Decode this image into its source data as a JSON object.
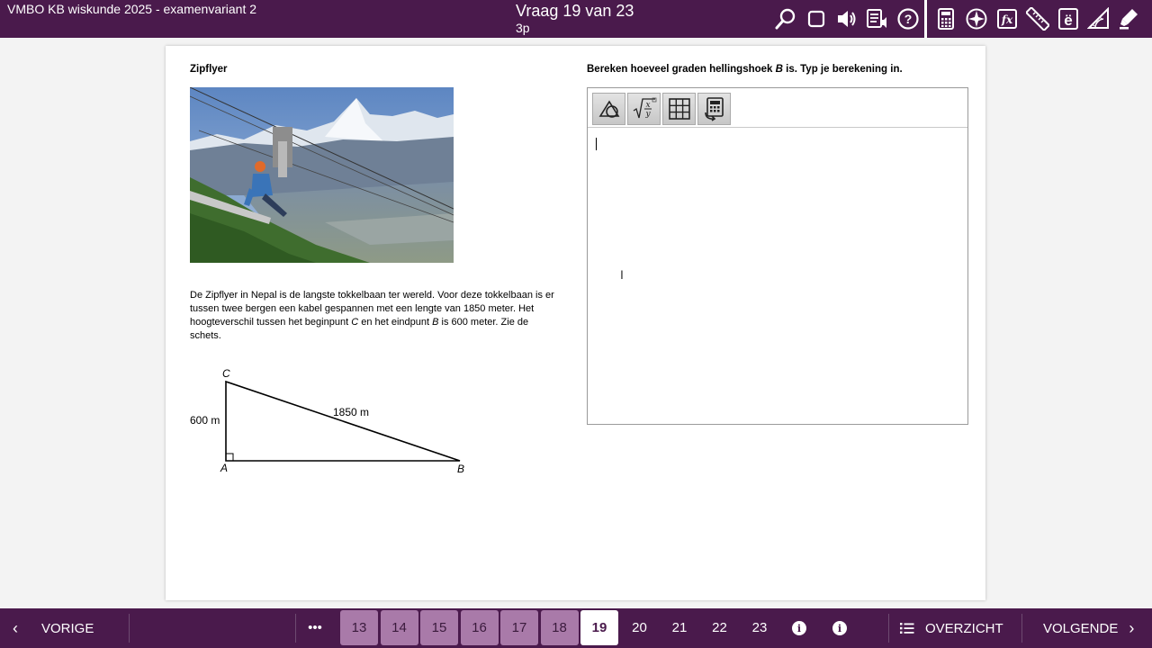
{
  "header": {
    "exam_title": "VMBO KB wiskunde 2025 - examenvariant 2",
    "question_title": "Vraag 19 van 23",
    "points": "3p",
    "tools_left": [
      "search-icon",
      "stop-icon",
      "speaker-icon",
      "read-aloud-icon",
      "help-icon"
    ],
    "tools_right": [
      "calculator-icon",
      "compass-icon",
      "formula-icon",
      "ruler-icon",
      "character-icon",
      "protractor-icon",
      "highlighter-icon"
    ]
  },
  "left": {
    "title": "Zipflyer",
    "intro_parts": {
      "p1": "De Zipflyer in Nepal is de langste tokkelbaan ter wereld. Voor deze tokkelbaan is er tussen twee bergen een kabel gespannen met een lengte van 1850 meter. Het hoogteverschil tussen het beginpunt ",
      "c": "C",
      "p2": " en het eindpunt ",
      "b": "B",
      "p3": " is 600 meter. Zie de schets."
    },
    "triangle": {
      "label_c": "C",
      "label_a": "A",
      "label_b": "B",
      "side_ac": "600 m",
      "side_cb": "1850 m"
    }
  },
  "right": {
    "question_parts": {
      "p1": "Bereken hoeveel graden hellingshoek ",
      "b": "B",
      "p2": " is. Typ je berekening in."
    },
    "editor_tools": [
      "geometry-icon",
      "formula-editor-icon",
      "table-icon",
      "calculator-paste-icon"
    ],
    "answer_value": ""
  },
  "footer": {
    "prev_label": "VORIGE",
    "more_label": "•••",
    "questions": [
      {
        "num": "13",
        "state": "visited"
      },
      {
        "num": "14",
        "state": "visited"
      },
      {
        "num": "15",
        "state": "visited"
      },
      {
        "num": "16",
        "state": "visited"
      },
      {
        "num": "17",
        "state": "visited"
      },
      {
        "num": "18",
        "state": "visited"
      },
      {
        "num": "19",
        "state": "current"
      },
      {
        "num": "20",
        "state": "plain"
      },
      {
        "num": "21",
        "state": "plain"
      },
      {
        "num": "22",
        "state": "plain"
      },
      {
        "num": "23",
        "state": "plain"
      }
    ],
    "info_glyph": "i",
    "overview_label": "OVERZICHT",
    "next_label": "VOLGENDE"
  },
  "colors": {
    "brand": "#4a1a4c",
    "visited": "#a97aa9"
  }
}
